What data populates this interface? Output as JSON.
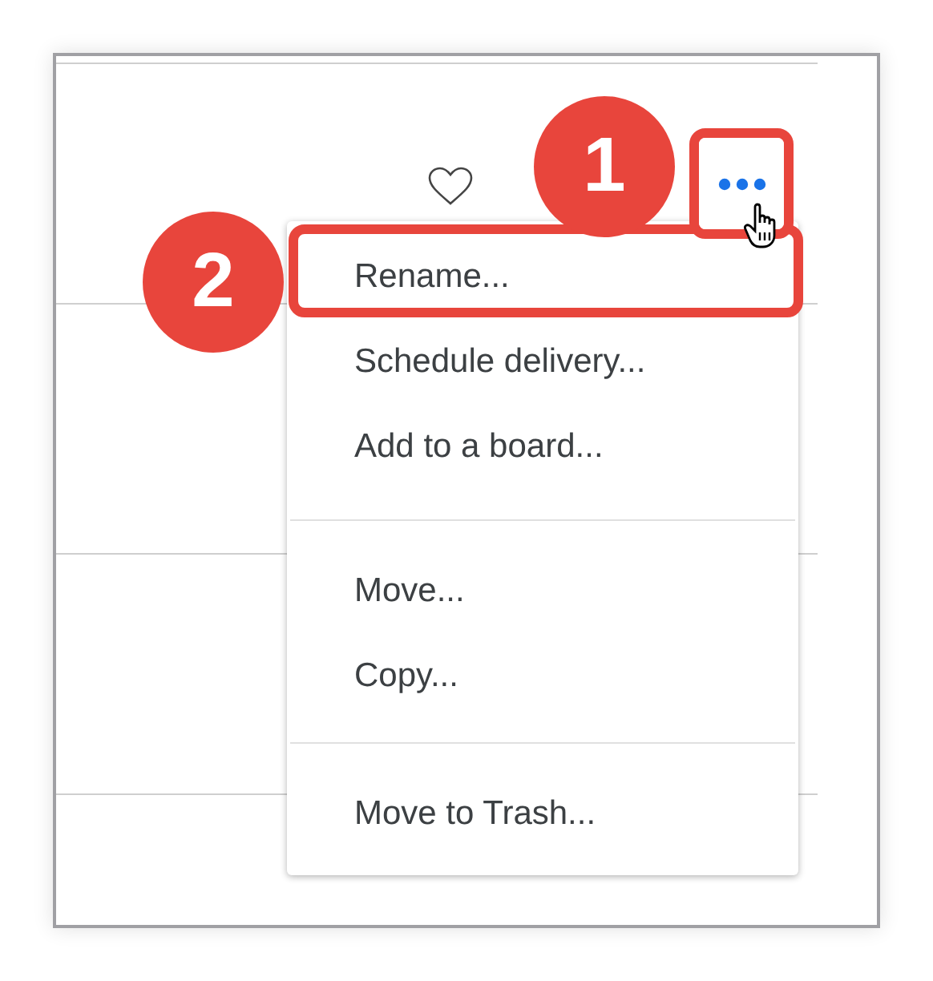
{
  "callouts": [
    {
      "number": "1"
    },
    {
      "number": "2"
    }
  ],
  "menu": {
    "groups": [
      {
        "items": [
          "Rename...",
          "Schedule delivery...",
          "Add to a board..."
        ]
      },
      {
        "items": [
          "Move...",
          "Copy..."
        ]
      },
      {
        "items": [
          "Move to Trash..."
        ]
      }
    ]
  }
}
